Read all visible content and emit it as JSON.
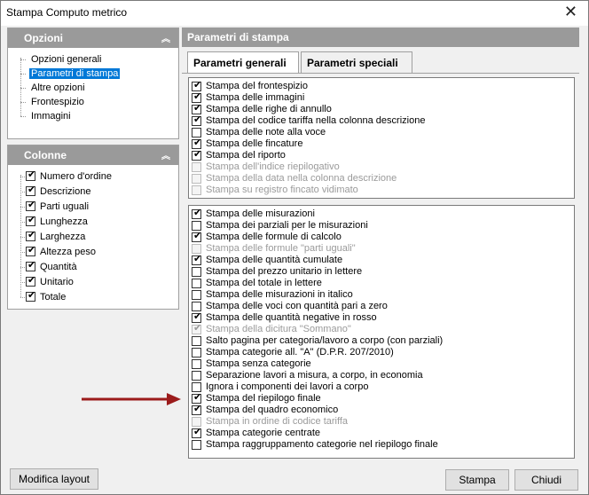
{
  "window": {
    "title": "Stampa Computo metrico",
    "close_icon": "close-icon"
  },
  "opzioni": {
    "header": "Opzioni",
    "items": [
      {
        "label": "Opzioni generali",
        "selected": false
      },
      {
        "label": "Parametri di stampa",
        "selected": true
      },
      {
        "label": "Altre opzioni",
        "selected": false
      },
      {
        "label": "Frontespizio",
        "selected": false
      },
      {
        "label": "Immagini",
        "selected": false
      }
    ]
  },
  "colonne": {
    "header": "Colonne",
    "items": [
      {
        "label": "Numero d'ordine",
        "checked": true
      },
      {
        "label": "Descrizione",
        "checked": true
      },
      {
        "label": "Parti uguali",
        "checked": true
      },
      {
        "label": "Lunghezza",
        "checked": true
      },
      {
        "label": "Larghezza",
        "checked": true
      },
      {
        "label": "Altezza peso",
        "checked": true
      },
      {
        "label": "Quantità",
        "checked": true
      },
      {
        "label": "Unitario",
        "checked": true
      },
      {
        "label": "Totale",
        "checked": true
      }
    ]
  },
  "parametri": {
    "header": "Parametri di stampa",
    "tabs": [
      {
        "label": "Parametri generali",
        "active": true
      },
      {
        "label": "Parametri speciali",
        "active": false
      }
    ],
    "list1": [
      {
        "label": "Stampa del frontespizio",
        "checked": true,
        "disabled": false
      },
      {
        "label": "Stampa delle immagini",
        "checked": true,
        "disabled": false
      },
      {
        "label": "Stampa delle righe di annullo",
        "checked": true,
        "disabled": false
      },
      {
        "label": "Stampa del codice tariffa nella colonna descrizione",
        "checked": true,
        "disabled": false
      },
      {
        "label": "Stampa delle note alla voce",
        "checked": false,
        "disabled": false
      },
      {
        "label": "Stampa delle fincature",
        "checked": true,
        "disabled": false
      },
      {
        "label": "Stampa del riporto",
        "checked": true,
        "disabled": false
      },
      {
        "label": "Stampa dell'indice riepilogativo",
        "checked": false,
        "disabled": true
      },
      {
        "label": "Stampa della data nella colonna descrizione",
        "checked": false,
        "disabled": true
      },
      {
        "label": "Stampa su registro fincato vidimato",
        "checked": false,
        "disabled": true
      }
    ],
    "list2": [
      {
        "label": "Stampa delle misurazioni",
        "checked": true,
        "disabled": false
      },
      {
        "label": "Stampa dei parziali per le misurazioni",
        "checked": false,
        "disabled": false
      },
      {
        "label": "Stampa delle formule di calcolo",
        "checked": true,
        "disabled": false
      },
      {
        "label": "Stampa delle formule \"parti uguali\"",
        "checked": false,
        "disabled": true
      },
      {
        "label": "Stampa delle quantità cumulate",
        "checked": true,
        "disabled": false
      },
      {
        "label": "Stampa del prezzo unitario in lettere",
        "checked": false,
        "disabled": false
      },
      {
        "label": "Stampa del totale in lettere",
        "checked": false,
        "disabled": false
      },
      {
        "label": "Stampa delle misurazioni in italico",
        "checked": false,
        "disabled": false
      },
      {
        "label": "Stampa delle voci con quantità pari a zero",
        "checked": false,
        "disabled": false
      },
      {
        "label": "Stampa delle quantità negative in rosso",
        "checked": true,
        "disabled": false
      },
      {
        "label": "Stampa della dicitura \"Sommano\"",
        "checked": true,
        "disabled": true
      },
      {
        "label": "Salto pagina per categoria/lavoro a corpo (con parziali)",
        "checked": false,
        "disabled": false
      },
      {
        "label": "Stampa categorie all. \"A\" (D.P.R. 207/2010)",
        "checked": false,
        "disabled": false
      },
      {
        "label": "Stampa senza categorie",
        "checked": false,
        "disabled": false
      },
      {
        "label": "Separazione lavori a misura, a corpo, in economia",
        "checked": false,
        "disabled": false
      },
      {
        "label": "Ignora i componenti dei lavori a corpo",
        "checked": false,
        "disabled": false
      },
      {
        "label": "Stampa del riepilogo finale",
        "checked": true,
        "disabled": false
      },
      {
        "label": "Stampa del quadro economico",
        "checked": true,
        "disabled": false
      },
      {
        "label": "Stampa in ordine di codice tariffa",
        "checked": false,
        "disabled": true
      },
      {
        "label": "Stampa categorie centrate",
        "checked": true,
        "disabled": false
      },
      {
        "label": "Stampa raggruppamento categorie nel riepilogo finale",
        "checked": false,
        "disabled": false
      }
    ]
  },
  "buttons": {
    "modifica": "Modifica layout",
    "stampa": "Stampa",
    "chiudi": "Chiudi"
  },
  "annotation": {
    "arrow_color": "#9b1b1b",
    "points_to": "Stampa del riepilogo finale"
  }
}
